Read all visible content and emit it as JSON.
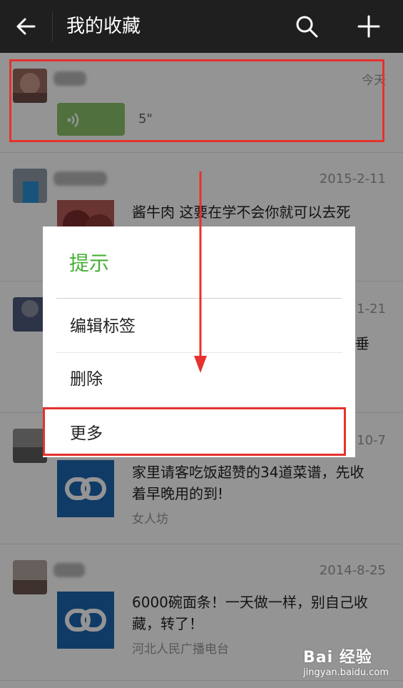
{
  "header": {
    "title": "我的收藏",
    "back_icon": "arrow-left-icon",
    "search_icon": "search-icon",
    "add_icon": "plus-icon"
  },
  "items": [
    {
      "type": "voice",
      "date": "今天",
      "duration": "5\""
    },
    {
      "type": "article",
      "date": "2015-2-11",
      "text": "酱牛肉 这要在学不会你就可以去死"
    },
    {
      "type": "article",
      "date": "1-21",
      "text_tail": "垂"
    },
    {
      "type": "link",
      "date": "10-7",
      "text": "家里请客吃饭超赞的34道菜谱，先收着早晚用的到!",
      "source": "女人坊"
    },
    {
      "type": "link",
      "date": "2014-8-25",
      "text": "6000碗面条！一天做一样，别自己收藏，转了！",
      "source": "河北人民广播电台"
    }
  ],
  "dialog": {
    "title": "提示",
    "options": [
      "编辑标签",
      "删除",
      "更多"
    ]
  },
  "colors": {
    "topbar": "#1f1f1f",
    "accent_green": "#46b036",
    "voice_bubble": "#8bc36a",
    "link_thumb": "#1e67b2",
    "annotation_red": "#e5322d"
  },
  "watermark": {
    "logo": "Bai 经验",
    "url": "jingyan.baidu.com"
  }
}
